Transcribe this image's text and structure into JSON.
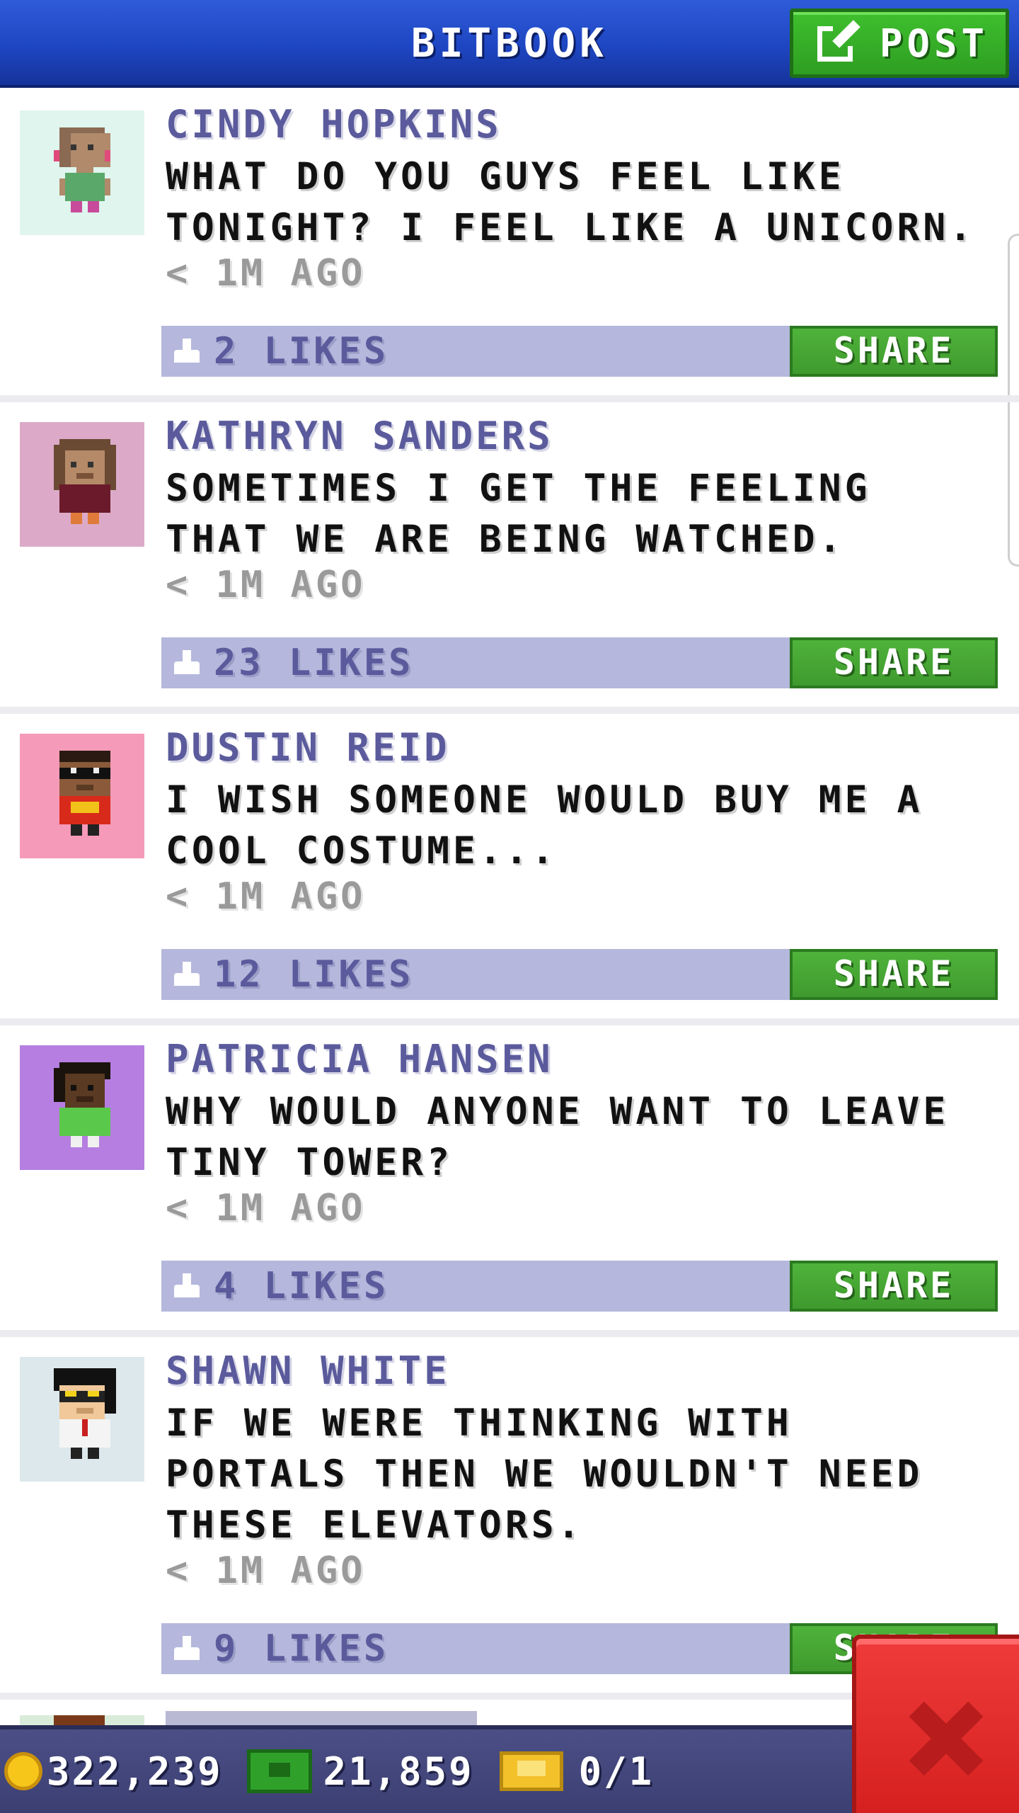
{
  "header": {
    "title": "BITBOOK",
    "post_label": "POST"
  },
  "posts": [
    {
      "author": "CINDY HOPKINS",
      "message": "WHAT DO YOU GUYS FEEL LIKE TONIGHT? I FEEL LIKE A UNICORN.",
      "time": "< 1M AGO",
      "likes": "2 LIKES",
      "share_label": "SHARE"
    },
    {
      "author": "KATHRYN SANDERS",
      "message": "SOMETIMES I GET THE FEELING THAT WE ARE BEING WATCHED.",
      "time": "< 1M AGO",
      "likes": "23 LIKES",
      "share_label": "SHARE"
    },
    {
      "author": "DUSTIN REID",
      "message": "I WISH SOMEONE WOULD BUY ME A COOL COSTUME...",
      "time": "< 1M AGO",
      "likes": "12 LIKES",
      "share_label": "SHARE"
    },
    {
      "author": "PATRICIA HANSEN",
      "message": "WHY WOULD ANYONE WANT TO LEAVE TINY TOWER?",
      "time": "< 1M AGO",
      "likes": "4 LIKES",
      "share_label": "SHARE"
    },
    {
      "author": "SHAWN WHITE",
      "message": "IF WE WERE THINKING WITH PORTALS THEN WE WOULDN'T NEED THESE ELEVATORS.",
      "time": "< 1M AGO",
      "likes": "9 LIKES",
      "share_label": "SHARE"
    }
  ],
  "status_bar": {
    "coins": "322,239",
    "bux": "21,859",
    "tickets": "0/1"
  },
  "colors": {
    "header_blue": "#1e46c2",
    "share_green": "#4fb33a",
    "likes_bar": "#b5b8dc",
    "author_purple": "#5a5a9c",
    "close_red": "#d62020"
  }
}
